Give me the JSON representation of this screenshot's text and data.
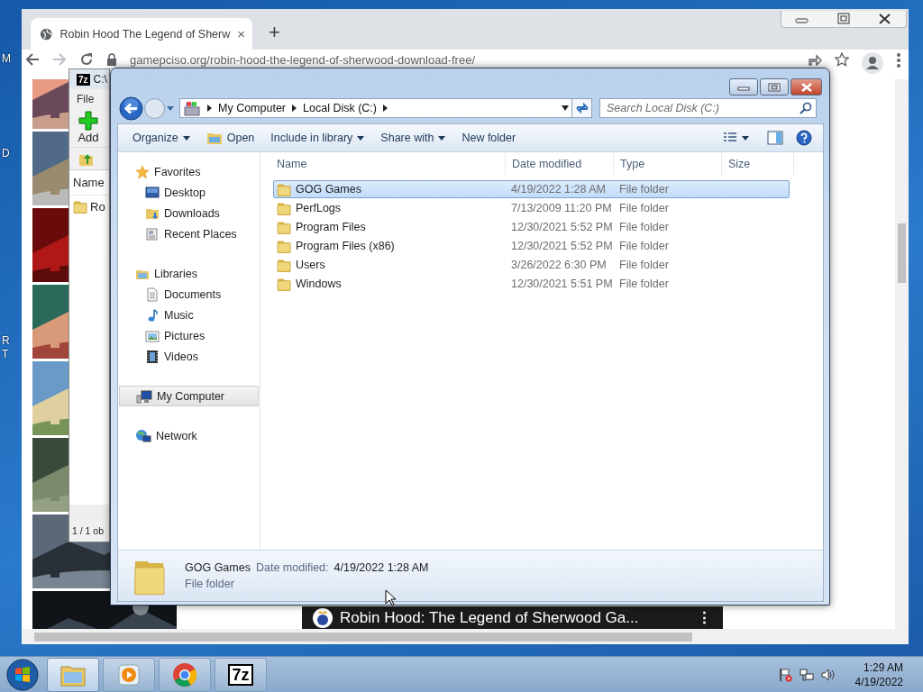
{
  "desktop": {
    "icon_labels": [
      "M",
      "D",
      "R",
      "T"
    ]
  },
  "browser": {
    "tab": {
      "title": "Robin Hood The Legend of Sherw",
      "close": "×"
    },
    "new_tab": "+",
    "url": "gamepciso.org/robin-hood-the-legend-of-sherwood-download-free/",
    "video": {
      "title": "Robin Hood: The Legend of Sherwood Ga...",
      "menu": "⋮"
    }
  },
  "archiver": {
    "icon": "7z",
    "title": "C:\\",
    "menu": [
      "File"
    ],
    "toolbar": [
      "Add"
    ],
    "column": "Name",
    "row": "Ro",
    "status": "1 / 1 ob"
  },
  "explorer": {
    "breadcrumb": [
      "My Computer",
      "Local Disk (C:)"
    ],
    "search": {
      "placeholder": "Search Local Disk (C:)"
    },
    "toolbar": [
      {
        "label": "Organize",
        "kind": "menu"
      },
      {
        "label": "Open",
        "kind": "icon"
      },
      {
        "label": "Include in library",
        "kind": "menu"
      },
      {
        "label": "Share with",
        "kind": "menu"
      },
      {
        "label": "New folder",
        "kind": "plain"
      }
    ],
    "nav": [
      {
        "label": "Favorites",
        "kind": "star",
        "selected": false,
        "children": [
          {
            "label": "Desktop",
            "kind": "desktop",
            "selected": false
          },
          {
            "label": "Downloads",
            "kind": "downloads",
            "selected": false
          },
          {
            "label": "Recent Places",
            "kind": "recent",
            "selected": false
          }
        ]
      },
      {
        "label": "Libraries",
        "kind": "libraries",
        "selected": false,
        "children": [
          {
            "label": "Documents",
            "kind": "documents",
            "selected": false
          },
          {
            "label": "Music",
            "kind": "music",
            "selected": false
          },
          {
            "label": "Pictures",
            "kind": "pictures",
            "selected": false
          },
          {
            "label": "Videos",
            "kind": "videos",
            "selected": false
          }
        ]
      },
      {
        "label": "My Computer",
        "kind": "computer",
        "selected": true
      },
      {
        "label": "Network",
        "kind": "network",
        "selected": false
      }
    ],
    "columns": [
      "Name",
      "Date modified",
      "Type",
      "Size"
    ],
    "rows": [
      {
        "name": "GOG Games",
        "date": "4/19/2022 1:28 AM",
        "type": "File folder",
        "selected": true
      },
      {
        "name": "PerfLogs",
        "date": "7/13/2009 11:20 PM",
        "type": "File folder",
        "selected": false
      },
      {
        "name": "Program Files",
        "date": "12/30/2021 5:52 PM",
        "type": "File folder",
        "selected": false
      },
      {
        "name": "Program Files (x86)",
        "date": "12/30/2021 5:52 PM",
        "type": "File folder",
        "selected": false
      },
      {
        "name": "Users",
        "date": "3/26/2022 6:30 PM",
        "type": "File folder",
        "selected": false
      },
      {
        "name": "Windows",
        "date": "12/30/2021 5:51 PM",
        "type": "File folder",
        "selected": false
      }
    ],
    "details": {
      "name": "GOG Games",
      "date_label": "Date modified:",
      "date": "4/19/2022 1:28 AM",
      "type": "File folder"
    }
  },
  "taskbar": {
    "buttons": [
      {
        "kind": "explorer",
        "selected": true
      },
      {
        "kind": "media",
        "selected": false
      },
      {
        "kind": "chrome",
        "selected": false
      },
      {
        "kind": "archiver",
        "label": "7z",
        "selected": false
      }
    ],
    "clock": {
      "time": "1:29 AM",
      "date": "4/19/2022"
    }
  }
}
